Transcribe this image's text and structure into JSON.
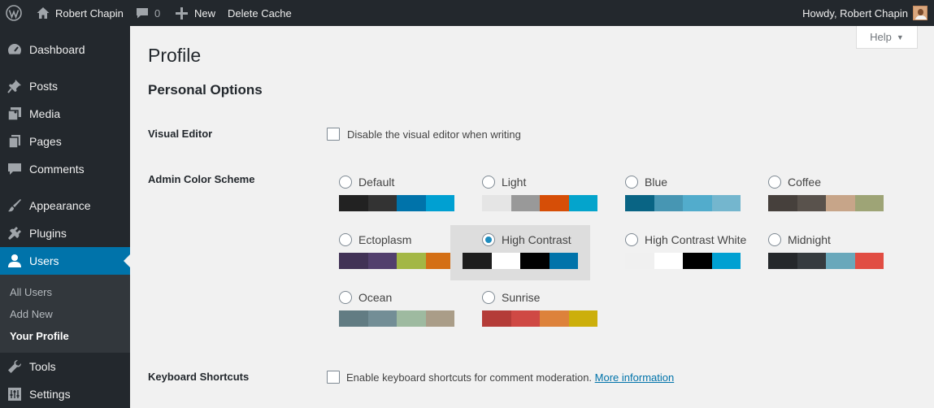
{
  "admin_bar": {
    "site_name": "Robert Chapin",
    "comments_count": "0",
    "new_label": "New",
    "delete_cache_label": "Delete Cache",
    "howdy": "Howdy, Robert Chapin"
  },
  "sidebar": {
    "items": [
      {
        "label": "Dashboard",
        "icon": "dashboard-icon"
      },
      {
        "label": "Posts",
        "icon": "pin-icon"
      },
      {
        "label": "Media",
        "icon": "media-icon"
      },
      {
        "label": "Pages",
        "icon": "pages-icon"
      },
      {
        "label": "Comments",
        "icon": "comment-icon"
      },
      {
        "label": "Appearance",
        "icon": "brush-icon"
      },
      {
        "label": "Plugins",
        "icon": "plug-icon"
      },
      {
        "label": "Users",
        "icon": "user-icon"
      },
      {
        "label": "Tools",
        "icon": "wrench-icon"
      },
      {
        "label": "Settings",
        "icon": "settings-icon"
      }
    ],
    "submenu": [
      "All Users",
      "Add New",
      "Your Profile"
    ]
  },
  "help_label": "Help",
  "page_title": "Profile",
  "section_title": "Personal Options",
  "visual_editor": {
    "label": "Visual Editor",
    "checkbox_label": "Disable the visual editor when writing",
    "checked": false
  },
  "color_scheme": {
    "label": "Admin Color Scheme",
    "selected": "High Contrast",
    "schemes": [
      {
        "name": "Default",
        "colors": [
          "#222222",
          "#333333",
          "#0073aa",
          "#00a0d2"
        ]
      },
      {
        "name": "Light",
        "colors": [
          "#e5e5e5",
          "#999999",
          "#d64e07",
          "#04a4cc"
        ]
      },
      {
        "name": "Blue",
        "colors": [
          "#096484",
          "#4796b3",
          "#52accc",
          "#74b6ce"
        ]
      },
      {
        "name": "Coffee",
        "colors": [
          "#46403c",
          "#59524c",
          "#c7a589",
          "#9ea476"
        ]
      },
      {
        "name": "Ectoplasm",
        "colors": [
          "#413256",
          "#523f6d",
          "#a3b745",
          "#d46f15"
        ]
      },
      {
        "name": "High Contrast",
        "colors": [
          "#1e1e1e",
          "#ffffff",
          "#000000",
          "#0073aa"
        ]
      },
      {
        "name": "High Contrast White",
        "colors": [
          "#f0f0f0",
          "#ffffff",
          "#000000",
          "#00a0d2"
        ]
      },
      {
        "name": "Midnight",
        "colors": [
          "#25282b",
          "#363b3f",
          "#69a8bb",
          "#e14d43"
        ]
      },
      {
        "name": "Ocean",
        "colors": [
          "#627c83",
          "#738e96",
          "#9ebaa0",
          "#aa9d88"
        ]
      },
      {
        "name": "Sunrise",
        "colors": [
          "#b43c38",
          "#cf4944",
          "#dd823b",
          "#ccaf0b"
        ]
      }
    ]
  },
  "keyboard_shortcuts": {
    "label": "Keyboard Shortcuts",
    "checkbox_label": "Enable keyboard shortcuts for comment moderation.",
    "link_label": "More information",
    "checked": false
  },
  "colors": {
    "accent": "#0073aa",
    "adminbar_bg": "#23282d",
    "link": "#0073aa"
  }
}
